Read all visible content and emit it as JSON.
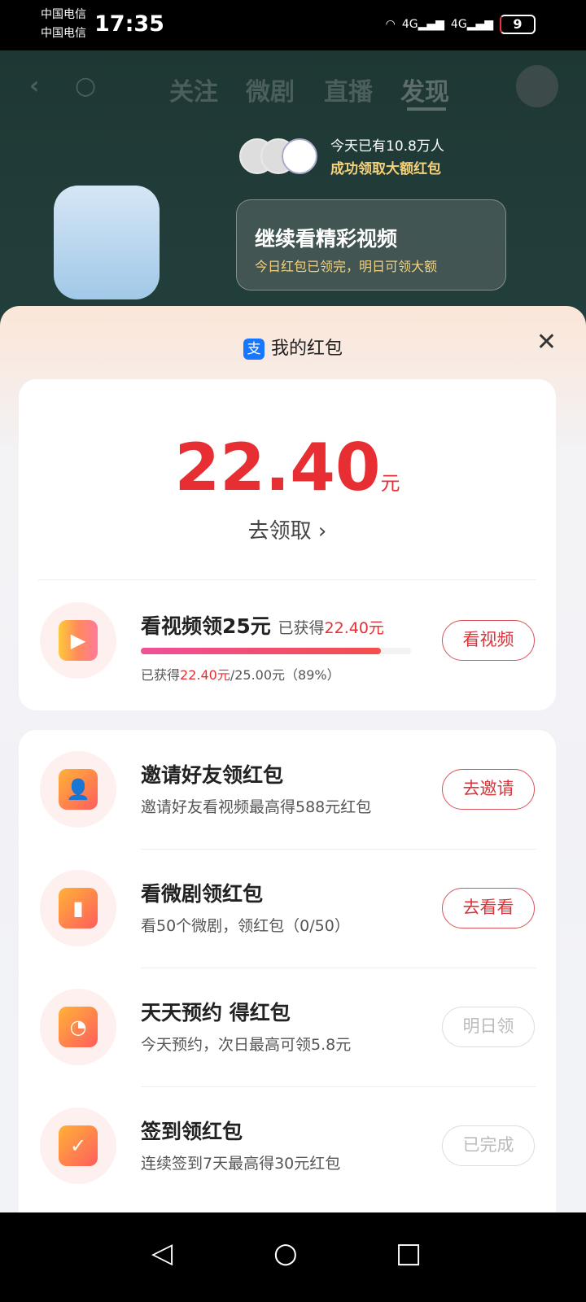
{
  "status_bar": {
    "carrier1": "中国电信",
    "carrier2": "中国电信",
    "time": "17:35",
    "network1": "4G",
    "network2": "4G",
    "battery": "9"
  },
  "top_nav": {
    "tabs": [
      {
        "label": "关注"
      },
      {
        "label": "微剧"
      },
      {
        "label": "直播"
      },
      {
        "label": "发现",
        "active": true
      }
    ]
  },
  "promo": {
    "line1": "今天已有10.8万人",
    "line2": "成功领取大额红包",
    "bubble_title": "继续看精彩视频",
    "bubble_sub": "今日红包已领完，明日可领大额"
  },
  "sheet": {
    "title": "我的红包",
    "alipay_glyph": "支",
    "balance": {
      "amount": "22.40",
      "unit": "元",
      "claim_label": "去领取"
    },
    "video_task": {
      "title": "看视频领25元",
      "earned_prefix": "已获得",
      "earned": "22.40元",
      "progress_prefix": "已获得",
      "progress_earned": "22.40元",
      "progress_rest": "/25.00元（89%）",
      "progress_percent": 89,
      "button": "看视频"
    },
    "tasks": [
      {
        "title": "邀请好友领红包",
        "subtitle": "邀请好友看视频最高得588元红包",
        "button": "去邀请",
        "enabled": true,
        "icon": "invite-user-icon"
      },
      {
        "title": "看微剧领红包",
        "subtitle": "看50个微剧，领红包（0/50）",
        "button": "去看看",
        "enabled": true,
        "icon": "tv-icon"
      },
      {
        "title": "天天预约 得红包",
        "subtitle": "今天预约，次日最高可领5.8元",
        "button": "明日领",
        "enabled": false,
        "icon": "clock-icon"
      },
      {
        "title": "签到领红包",
        "subtitle": "连续签到7天最高得30元红包",
        "button": "已完成",
        "enabled": false,
        "icon": "calendar-check-icon"
      }
    ]
  },
  "colors": {
    "accent": "#e62e33",
    "alipay": "#1677ff"
  }
}
